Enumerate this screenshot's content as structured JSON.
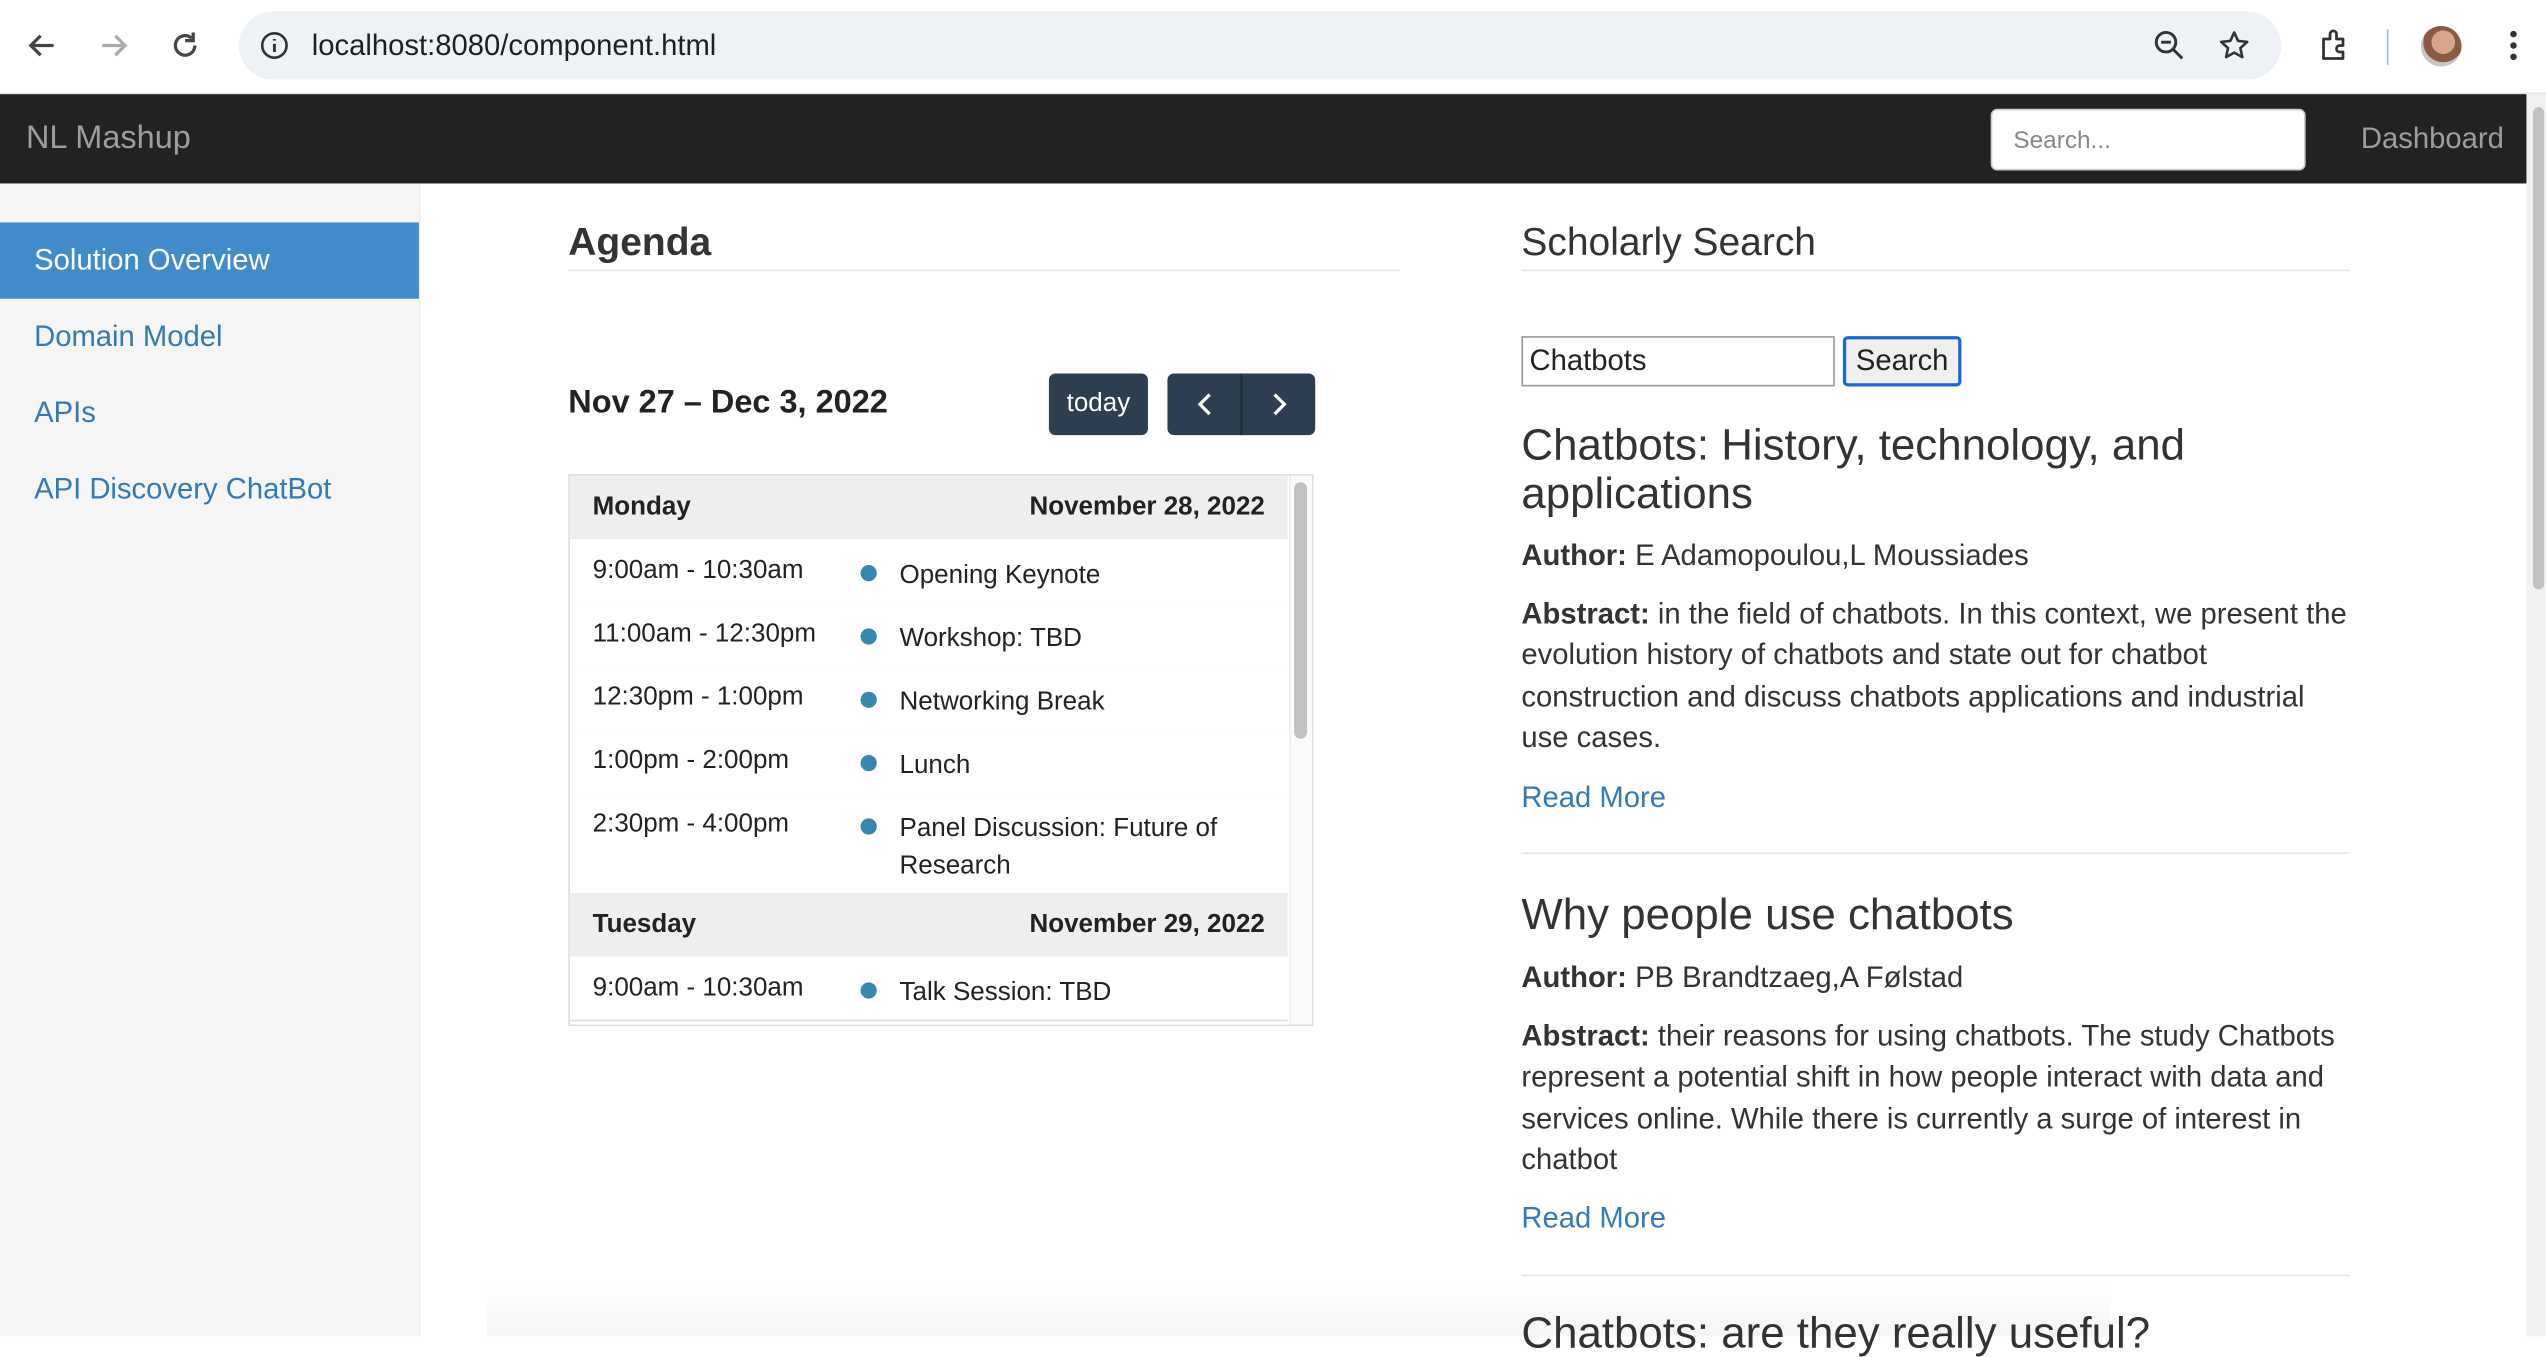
{
  "browser": {
    "url": "localhost:8080/component.html",
    "icons": [
      "back-icon",
      "forward-icon",
      "reload-icon",
      "info-icon",
      "zoom-icon",
      "star-icon",
      "extensions-icon",
      "profile-avatar",
      "menu-icon"
    ]
  },
  "navbar": {
    "brand": "NL Mashup",
    "search_placeholder": "Search...",
    "dashboard": "Dashboard"
  },
  "sidebar": {
    "items": [
      {
        "label": "Solution Overview",
        "active": true
      },
      {
        "label": "Domain Model",
        "active": false
      },
      {
        "label": "APIs",
        "active": false
      },
      {
        "label": "API Discovery ChatBot",
        "active": false
      }
    ]
  },
  "agenda": {
    "title": "Agenda",
    "range": "Nov 27 – Dec 3, 2022",
    "today": "today",
    "days": [
      {
        "name": "Monday",
        "date": "November 28, 2022",
        "events": [
          {
            "time": "9:00am - 10:30am",
            "title": "Opening Keynote"
          },
          {
            "time": "11:00am - 12:30pm",
            "title": "Workshop: TBD"
          },
          {
            "time": "12:30pm - 1:00pm",
            "title": "Networking Break"
          },
          {
            "time": "1:00pm - 2:00pm",
            "title": "Lunch"
          },
          {
            "time": "2:30pm - 4:00pm",
            "title": "Panel Discussion: Future of Research"
          }
        ]
      },
      {
        "name": "Tuesday",
        "date": "November 29, 2022",
        "events": [
          {
            "time": "9:00am - 10:30am",
            "title": "Talk Session: TBD"
          }
        ]
      }
    ]
  },
  "scholarly": {
    "title": "Scholarly Search",
    "query": "Chatbots",
    "search_button": "Search",
    "author_label": "Author:",
    "abstract_label": "Abstract:",
    "read_more": "Read More",
    "results": [
      {
        "title": "Chatbots: History, technology, and applications",
        "author": "E Adamopoulou,L Moussiades",
        "abstract": "in the field of chatbots. In this context, we present the evolution history of chatbots and state out for chatbot construction and discuss chatbots applications and industrial use cases."
      },
      {
        "title": "Why people use chatbots",
        "author": "PB Brandtzaeg,A Følstad",
        "abstract": "their reasons for using chatbots. The study Chatbots represent a potential shift in how people interact with data and services online. While there is currently a surge of interest in chatbot"
      },
      {
        "title": "Chatbots: are they really useful?",
        "author": "",
        "abstract": ""
      }
    ]
  },
  "colors": {
    "navbar_bg": "#222222",
    "sidebar_active": "#428bca",
    "link": "#337ab7",
    "calendar_button": "#2c3e50",
    "event_dot": "#3a87ad"
  }
}
